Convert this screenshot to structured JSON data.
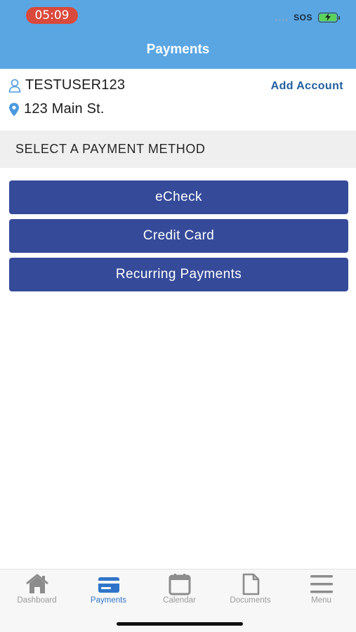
{
  "status": {
    "time": "05:09",
    "sos": "SOS"
  },
  "header": {
    "title": "Payments"
  },
  "account": {
    "user": "TESTUSER123",
    "address": "123 Main St.",
    "add_account_label": "Add Account"
  },
  "section": {
    "title": "SELECT A PAYMENT METHOD"
  },
  "methods": [
    {
      "label": "eCheck"
    },
    {
      "label": "Credit Card"
    },
    {
      "label": "Recurring Payments"
    }
  ],
  "tabs": [
    {
      "label": "Dashboard",
      "icon": "home-icon"
    },
    {
      "label": "Payments",
      "icon": "credit-card-icon",
      "active": true
    },
    {
      "label": "Calendar",
      "icon": "calendar-icon"
    },
    {
      "label": "Documents",
      "icon": "document-icon"
    },
    {
      "label": "Menu",
      "icon": "menu-icon"
    }
  ],
  "colors": {
    "header": "#5aa6e3",
    "button": "#354a99",
    "accent": "#2f74c8",
    "link": "#1f5f9e",
    "time_pill": "#d94a3d"
  }
}
